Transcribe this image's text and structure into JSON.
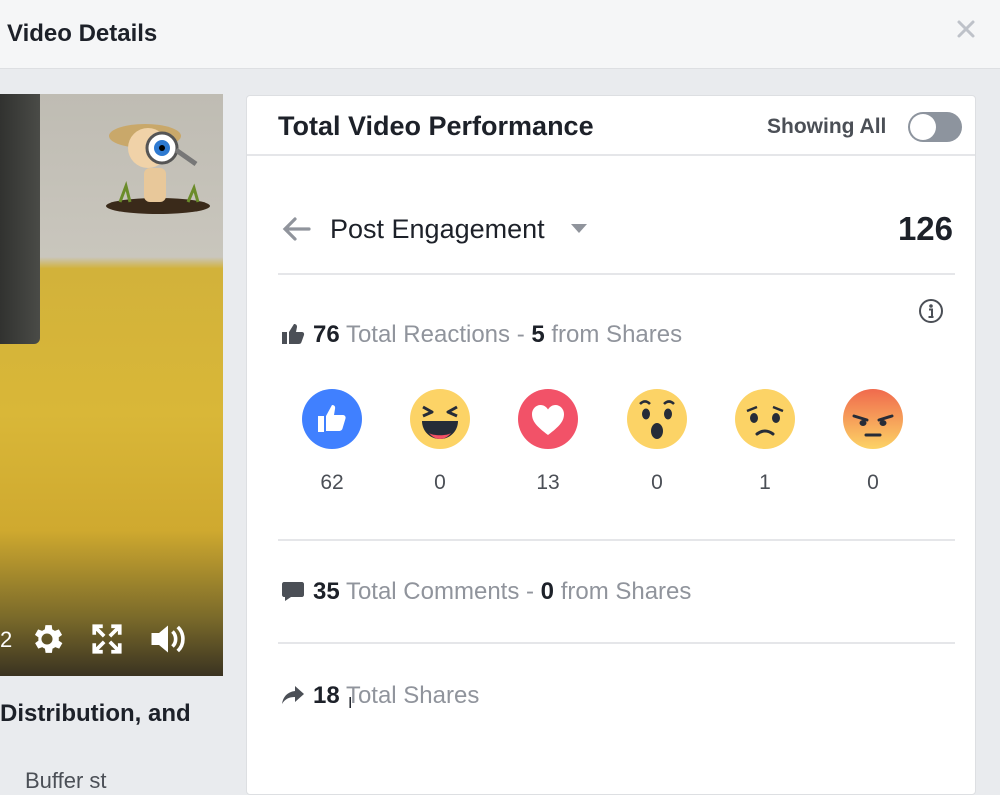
{
  "dialog": {
    "title": "Video Details"
  },
  "video": {
    "time_fragment": "2",
    "caption": "Distribution, and",
    "caption_partial": "Buffer st"
  },
  "panel": {
    "title": "Total Video Performance",
    "toggle_label": "Showing All",
    "toggle_on": false
  },
  "metric": {
    "selected": "Post Engagement",
    "total": "126"
  },
  "reactions_summary": {
    "count": "76",
    "label": "Total Reactions",
    "sep": " - ",
    "shares_count": "5",
    "shares_label": "from Shares"
  },
  "reactions": [
    {
      "type": "like",
      "count": "62"
    },
    {
      "type": "haha",
      "count": "0"
    },
    {
      "type": "love",
      "count": "13"
    },
    {
      "type": "wow",
      "count": "0"
    },
    {
      "type": "sad",
      "count": "1"
    },
    {
      "type": "angry",
      "count": "0"
    }
  ],
  "comments_summary": {
    "count": "35",
    "label": "Total Comments",
    "sep": " - ",
    "shares_count": "0",
    "shares_label": "from Shares"
  },
  "shares_summary": {
    "count": "18",
    "label": "Total Shares"
  },
  "colors": {
    "like_blue": "#4080ff",
    "love_red": "#f25268",
    "emoji_yellow": "#fcd366",
    "angry_orange": "#f06a4d",
    "muted_text": "#90949c"
  }
}
